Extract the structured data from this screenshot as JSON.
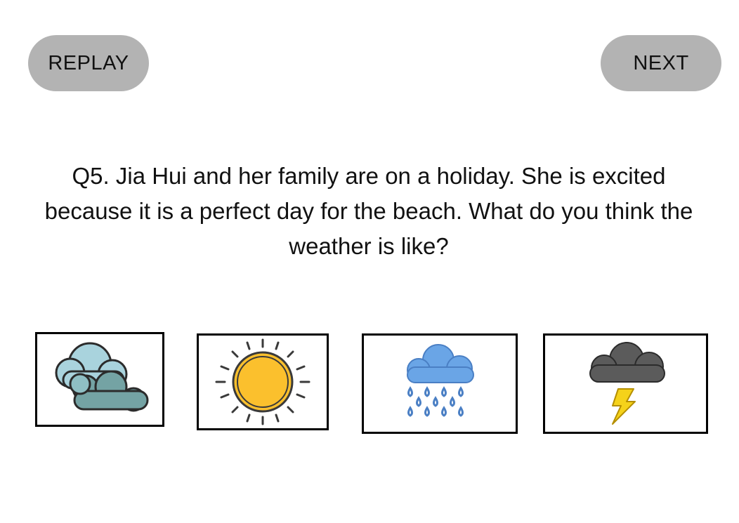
{
  "header": {
    "replay_label": "REPLAY",
    "next_label": "NEXT"
  },
  "question": {
    "text": "Q5. Jia Hui and her family are on a holiday. She is excited because it is a perfect day for the beach. What do you think the weather is like?"
  },
  "options": [
    {
      "icon": "cloudy-icon",
      "colors": {
        "front": "#74a3a4",
        "back": "#a9d3dd",
        "outline": "#2b2b2b"
      }
    },
    {
      "icon": "sun-icon",
      "colors": {
        "fill": "#fbc02d",
        "outline": "#3a3a3a"
      }
    },
    {
      "icon": "rain-cloud-icon",
      "colors": {
        "cloud": "#6aa5e6",
        "drops": "#4a7fc4"
      }
    },
    {
      "icon": "storm-cloud-icon",
      "colors": {
        "cloud": "#5b5b5b",
        "bolt": "#f5d21a"
      }
    }
  ],
  "colors": {
    "button_bg": "#b3b3b3",
    "option_border": "#000000"
  }
}
